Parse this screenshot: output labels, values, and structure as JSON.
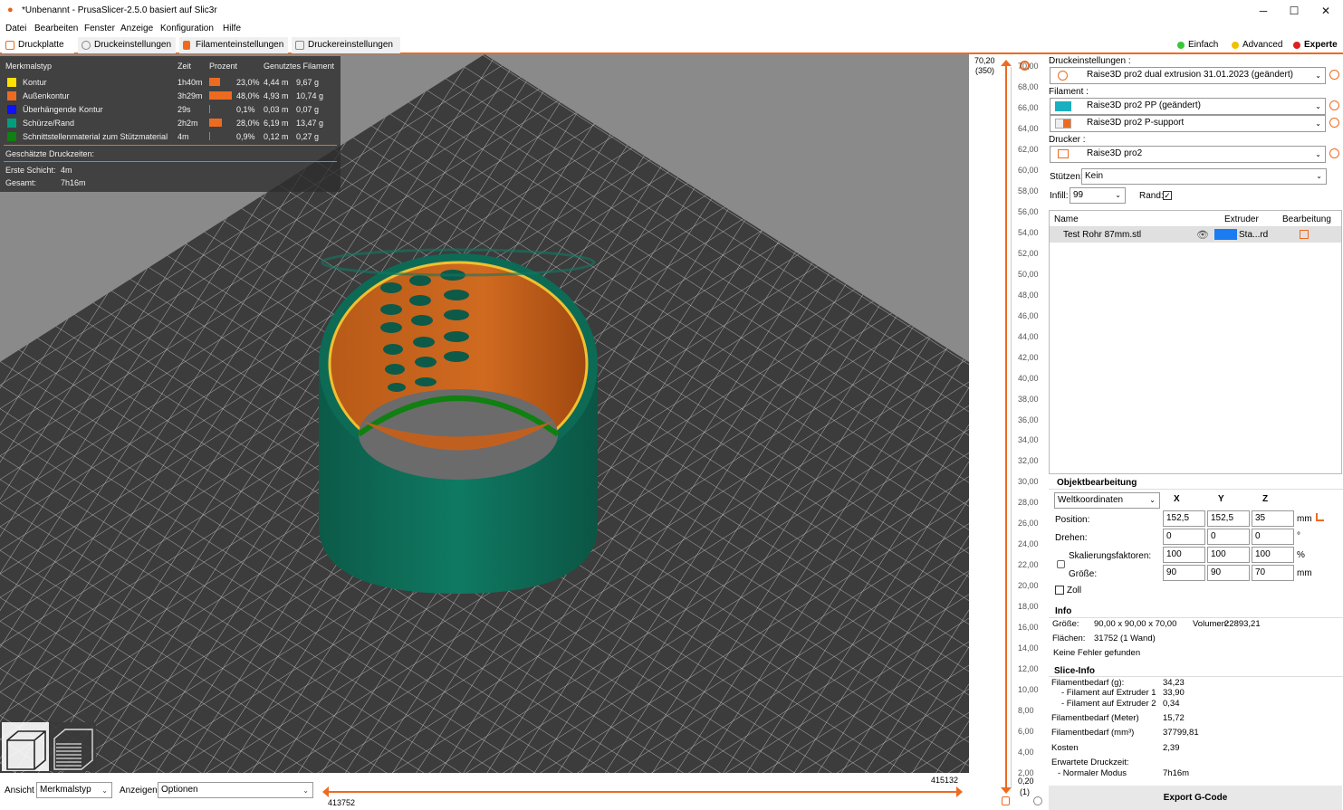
{
  "window": {
    "title": "*Unbenannt - PrusaSlicer-2.5.0 basiert auf Slic3r",
    "minimize": "─",
    "maximize": "☐",
    "close": "✕"
  },
  "menu": [
    "Datei",
    "Bearbeiten",
    "Fenster",
    "Anzeige",
    "Konfiguration",
    "Hilfe"
  ],
  "tabs": [
    {
      "label": "Druckplatte",
      "active": true
    },
    {
      "label": "Druckeinstellungen"
    },
    {
      "label": "Filamenteinstellungen"
    },
    {
      "label": "Druckereinstellungen"
    }
  ],
  "modes": [
    {
      "label": "Einfach",
      "color": "#37c837"
    },
    {
      "label": "Advanced",
      "color": "#f0c000"
    },
    {
      "label": "Experte",
      "color": "#e02020",
      "active": true
    }
  ],
  "legend": {
    "headers": {
      "type": "Merkmalstyp",
      "time": "Zeit",
      "percent": "Prozent",
      "filament": "Genutztes Filament"
    },
    "rows": [
      {
        "name": "Kontur",
        "color": "#ffe000",
        "time": "1h40m",
        "percent": "23,0%",
        "pct": 23.0,
        "meters": "4,44 m",
        "grams": "9,67 g"
      },
      {
        "name": "Außenkontur",
        "color": "#ed6b21",
        "time": "3h29m",
        "percent": "48,0%",
        "pct": 48.0,
        "meters": "4,93 m",
        "grams": "10,74 g"
      },
      {
        "name": "Überhängende Kontur",
        "color": "#1010ff",
        "time": "29s",
        "percent": "0,1%",
        "pct": 0.1,
        "meters": "0,03 m",
        "grams": "0,07 g"
      },
      {
        "name": "Schürze/Rand",
        "color": "#009e7e",
        "time": "2h2m",
        "percent": "28,0%",
        "pct": 28.0,
        "meters": "6,19 m",
        "grams": "13,47 g"
      },
      {
        "name": "Schnittstellenmaterial zum Stützmaterial",
        "color": "#108010",
        "time": "4m",
        "percent": "0,9%",
        "pct": 0.9,
        "meters": "0,12 m",
        "grams": "0,27 g"
      }
    ],
    "estimated_label": "Geschätzte Druckzeiten:",
    "first_layer_label": "Erste Schicht:",
    "first_layer_value": "4m",
    "total_label": "Gesamt:",
    "total_value": "7h16m"
  },
  "bottombar": {
    "view_label": "Ansicht",
    "view_value": "Merkmalstyp",
    "show_label": "Anzeigen",
    "show_value": "Optionen",
    "h_min": "413752",
    "h_max": "415132"
  },
  "vslider": {
    "top_value": "70,20",
    "top_layer": "(350)",
    "bottom_value": "0,20",
    "bottom_layer": "(1)",
    "ticks": [
      "70,00",
      "68,00",
      "66,00",
      "64,00",
      "62,00",
      "60,00",
      "58,00",
      "56,00",
      "54,00",
      "52,00",
      "50,00",
      "48,00",
      "46,00",
      "44,00",
      "42,00",
      "40,00",
      "38,00",
      "36,00",
      "34,00",
      "32,00",
      "30,00",
      "28,00",
      "26,00",
      "24,00",
      "22,00",
      "20,00",
      "18,00",
      "16,00",
      "14,00",
      "12,00",
      "10,00",
      "8,00",
      "6,00",
      "4,00",
      "2,00"
    ]
  },
  "sidebar": {
    "print_settings_label": "Druckeinstellungen :",
    "print_settings_value": "Raise3D pro2 dual extrusion 31.01.2023 (geändert)",
    "filament_label": "Filament :",
    "filament1": "Raise3D pro2 PP (geändert)",
    "filament1_color": "#1ab0c0",
    "filament2": "Raise3D pro2 P-support",
    "filament2_color": "#ed6b21",
    "printer_label": "Drucker :",
    "printer_value": "Raise3D pro2",
    "supports_label": "Stützen:",
    "supports_value": "Kein",
    "infill_label": "Infill:",
    "infill_value": "99",
    "brim_label": "Rand:",
    "list_headers": {
      "name": "Name",
      "extruder": "Extruder",
      "edit": "Bearbeitung"
    },
    "objects": [
      {
        "name": "Test Rohr 87mm.stl",
        "extruder": "Sta...rd",
        "extruder_color": "#1a7cf0"
      }
    ],
    "objedit": {
      "title": "Objektbearbeitung",
      "coords": "Weltkoordinaten",
      "x": "X",
      "y": "Y",
      "z": "Z",
      "position_label": "Position:",
      "position": [
        "152,5",
        "152,5",
        "35"
      ],
      "position_unit": "mm",
      "rotate_label": "Drehen:",
      "rotate": [
        "0",
        "0",
        "0"
      ],
      "rotate_unit": "°",
      "scale_label": "Skalierungsfaktoren:",
      "scale": [
        "100",
        "100",
        "100"
      ],
      "scale_unit": "%",
      "size_label": "Größe:",
      "size": [
        "90",
        "90",
        "70"
      ],
      "size_unit": "mm",
      "inch_label": "Zoll"
    },
    "info": {
      "title": "Info",
      "size_label": "Größe:",
      "size_value": "90,00 x 90,00 x 70,00",
      "volume_label": "Volumen:",
      "volume_value": "22893,21",
      "facets_label": "Flächen:",
      "facets_value": "31752 (1 Wand)",
      "errors": "Keine Fehler gefunden"
    },
    "slice_info": {
      "title": "Slice-Info",
      "rows": [
        {
          "label": "Filamentbedarf (g):",
          "value": "34,23"
        },
        {
          "label": "- Filament auf Extruder 1",
          "value": "33,90"
        },
        {
          "label": "- Filament auf Extruder 2",
          "value": "0,34"
        },
        {
          "label": "Filamentbedarf (Meter)",
          "value": "15,72"
        },
        {
          "label": "Filamentbedarf (mm³)",
          "value": "37799,81"
        },
        {
          "label": "Kosten",
          "value": "2,39"
        },
        {
          "label": "Erwartete Druckzeit:",
          "value": ""
        },
        {
          "label": "- Normaler Modus",
          "value": "7h16m"
        }
      ]
    },
    "export_label": "Export G-Code"
  }
}
